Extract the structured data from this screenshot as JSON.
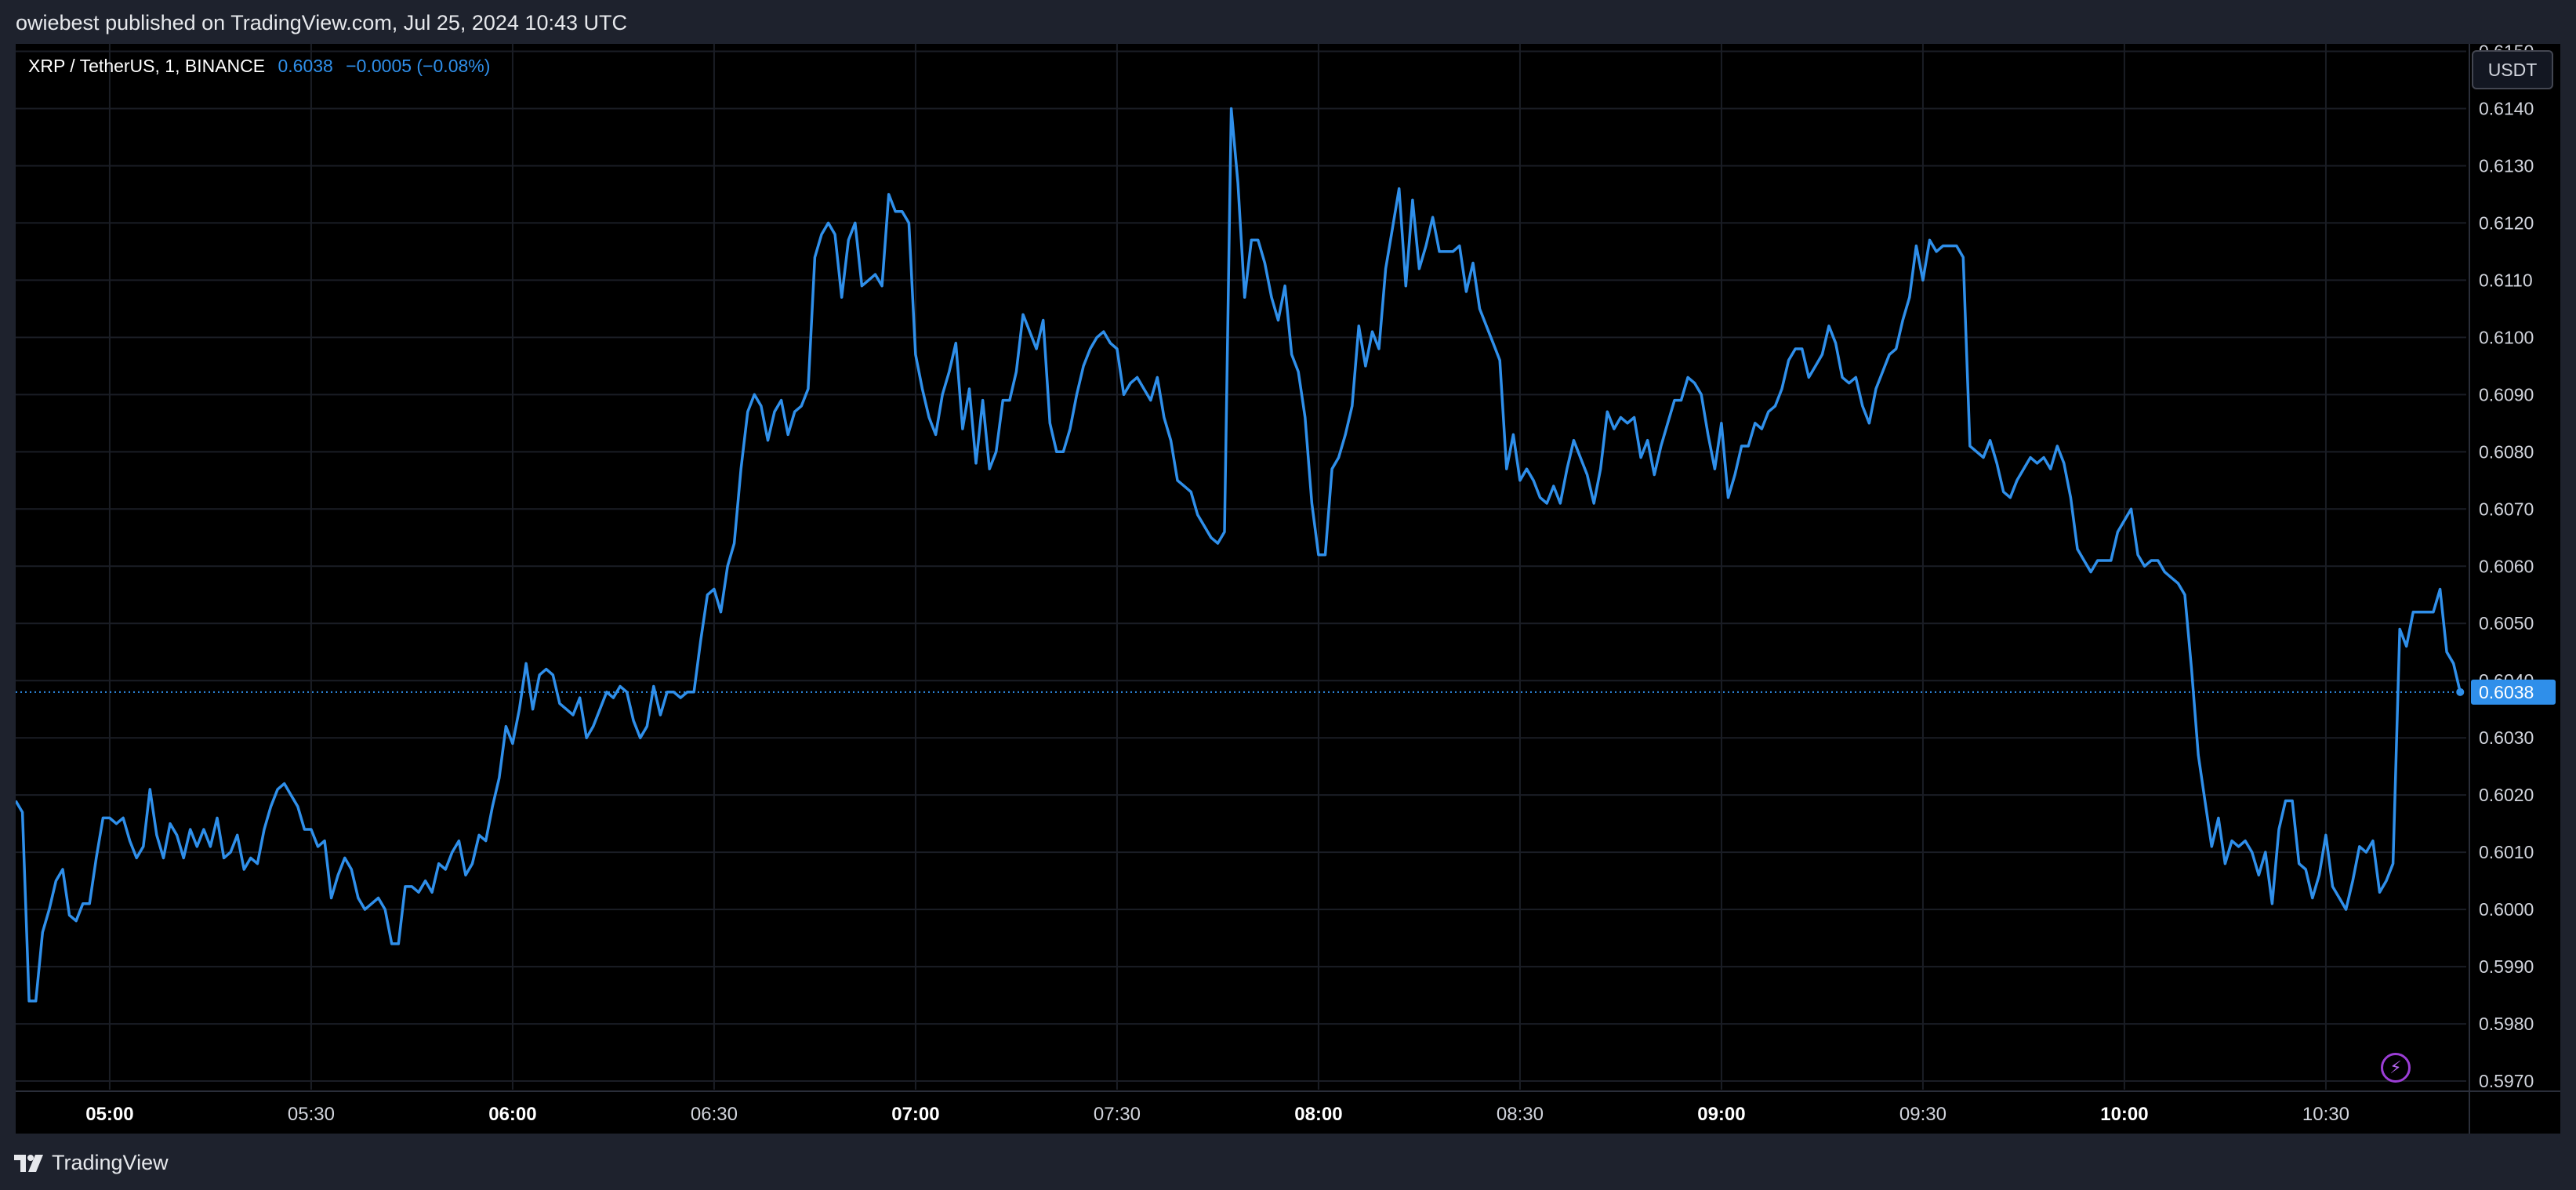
{
  "header": {
    "publisher": "owiebest published on TradingView.com, Jul 25, 2024 10:43 UTC"
  },
  "legend": {
    "symbol": "XRP / TetherUS, 1, BINANCE",
    "price": "0.6038",
    "change": "−0.0005 (−0.08%)"
  },
  "currency": "USDT",
  "footer": {
    "brand": "TradingView"
  },
  "colors": {
    "line": "#2f8fea",
    "background": "#000000",
    "frame": "#1e222d",
    "grid": "#1a1d25",
    "axis_text": "#d1d4dc",
    "badge": "#2f8fea"
  },
  "icons": [
    "tradingview-logo-icon",
    "lightning-icon"
  ],
  "chart_data": {
    "type": "line",
    "series": [
      {
        "values": [
          0.6019,
          0.6017,
          0.5984,
          0.5984,
          0.5996,
          0.6,
          0.6005,
          0.6007,
          0.5999,
          0.5998,
          0.6001,
          0.6001,
          0.6009,
          0.6016,
          0.6016,
          0.6015,
          0.6016,
          0.6012,
          0.6009,
          0.6011,
          0.6021,
          0.6013,
          0.6009,
          0.6015,
          0.6013,
          0.6009,
          0.6014,
          0.6011,
          0.6014,
          0.6011,
          0.6016,
          0.6009,
          0.601,
          0.6013,
          0.6007,
          0.6009,
          0.6008,
          0.6014,
          0.6018,
          0.6021,
          0.6022,
          0.602,
          0.6018,
          0.6014,
          0.6014,
          0.6011,
          0.6012,
          0.6002,
          0.6006,
          0.6009,
          0.6007,
          0.6002,
          0.6,
          0.6001,
          0.6002,
          0.6,
          0.5994,
          0.5994,
          0.6004,
          0.6004,
          0.6003,
          0.6005,
          0.6003,
          0.6008,
          0.6007,
          0.601,
          0.6012,
          0.6006,
          0.6008,
          0.6013,
          0.6012,
          0.6018,
          0.6023,
          0.6032,
          0.6029,
          0.6035,
          0.6043,
          0.6035,
          0.6041,
          0.6042,
          0.6041,
          0.6036,
          0.6035,
          0.6034,
          0.6037,
          0.603,
          0.6032,
          0.6035,
          0.6038,
          0.6037,
          0.6039,
          0.6038,
          0.6033,
          0.603,
          0.6032,
          0.6039,
          0.6034,
          0.6038,
          0.6038,
          0.6037,
          0.6038,
          0.6038,
          0.6047,
          0.6055,
          0.6056,
          0.6052,
          0.606,
          0.6064,
          0.6077,
          0.6087,
          0.609,
          0.6088,
          0.6082,
          0.6087,
          0.6089,
          0.6083,
          0.6087,
          0.6088,
          0.6091,
          0.6114,
          0.6118,
          0.612,
          0.6118,
          0.6107,
          0.6117,
          0.612,
          0.6109,
          0.611,
          0.6111,
          0.6109,
          0.6125,
          0.6122,
          0.6122,
          0.612,
          0.6097,
          0.6091,
          0.6086,
          0.6083,
          0.609,
          0.6094,
          0.6099,
          0.6084,
          0.6091,
          0.6078,
          0.6089,
          0.6077,
          0.608,
          0.6089,
          0.6089,
          0.6094,
          0.6104,
          0.6101,
          0.6098,
          0.6103,
          0.6085,
          0.608,
          0.608,
          0.6084,
          0.609,
          0.6095,
          0.6098,
          0.61,
          0.6101,
          0.6099,
          0.6098,
          0.609,
          0.6092,
          0.6093,
          0.6091,
          0.6089,
          0.6093,
          0.6086,
          0.6082,
          0.6075,
          0.6074,
          0.6073,
          0.6069,
          0.6067,
          0.6065,
          0.6064,
          0.6066,
          0.614,
          0.6127,
          0.6107,
          0.6117,
          0.6117,
          0.6113,
          0.6107,
          0.6103,
          0.6109,
          0.6097,
          0.6094,
          0.6086,
          0.6071,
          0.6062,
          0.6062,
          0.6077,
          0.6079,
          0.6083,
          0.6088,
          0.6102,
          0.6095,
          0.6101,
          0.6098,
          0.6112,
          0.6119,
          0.6126,
          0.6109,
          0.6124,
          0.6112,
          0.6116,
          0.6121,
          0.6115,
          0.6115,
          0.6115,
          0.6116,
          0.6108,
          0.6113,
          0.6105,
          0.6102,
          0.6099,
          0.6096,
          0.6077,
          0.6083,
          0.6075,
          0.6077,
          0.6075,
          0.6072,
          0.6071,
          0.6074,
          0.6071,
          0.6077,
          0.6082,
          0.6079,
          0.6076,
          0.6071,
          0.6077,
          0.6087,
          0.6084,
          0.6086,
          0.6085,
          0.6086,
          0.6079,
          0.6082,
          0.6076,
          0.6081,
          0.6085,
          0.6089,
          0.6089,
          0.6093,
          0.6092,
          0.609,
          0.6083,
          0.6077,
          0.6085,
          0.6072,
          0.6076,
          0.6081,
          0.6081,
          0.6085,
          0.6084,
          0.6087,
          0.6088,
          0.6091,
          0.6096,
          0.6098,
          0.6098,
          0.6093,
          0.6095,
          0.6097,
          0.6102,
          0.6099,
          0.6093,
          0.6092,
          0.6093,
          0.6088,
          0.6085,
          0.6091,
          0.6094,
          0.6097,
          0.6098,
          0.6103,
          0.6107,
          0.6116,
          0.611,
          0.6117,
          0.6115,
          0.6116,
          0.6116,
          0.6116,
          0.6114,
          0.6081,
          0.608,
          0.6079,
          0.6082,
          0.6078,
          0.6073,
          0.6072,
          0.6075,
          0.6077,
          0.6079,
          0.6078,
          0.6079,
          0.6077,
          0.6081,
          0.6078,
          0.6072,
          0.6063,
          0.6061,
          0.6059,
          0.6061,
          0.6061,
          0.6061,
          0.6066,
          0.6068,
          0.607,
          0.6062,
          0.606,
          0.6061,
          0.6061,
          0.6059,
          0.6058,
          0.6057,
          0.6055,
          0.6042,
          0.6027,
          0.6019,
          0.6011,
          0.6016,
          0.6008,
          0.6012,
          0.6011,
          0.6012,
          0.601,
          0.6006,
          0.601,
          0.6001,
          0.6014,
          0.6019,
          0.6019,
          0.6008,
          0.6007,
          0.6002,
          0.6006,
          0.6013,
          0.6004,
          0.6002,
          0.6,
          0.6005,
          0.6011,
          0.601,
          0.6012,
          0.6003,
          0.6005,
          0.6008,
          0.6049,
          0.6046,
          0.6052,
          0.6052,
          0.6052,
          0.6052,
          0.6056,
          0.6045,
          0.6043,
          0.6038
        ]
      }
    ],
    "x_start": "04:46",
    "x_step_minutes": 1,
    "x_ticks": [
      "05:00",
      "05:30",
      "06:00",
      "06:30",
      "07:00",
      "07:30",
      "08:00",
      "08:30",
      "09:00",
      "09:30",
      "10:00",
      "10:30"
    ],
    "x_ticks_bold": [
      "05:00",
      "06:00",
      "07:00",
      "08:00",
      "09:00",
      "10:00"
    ],
    "y_ticks": [
      "0.5970",
      "0.5980",
      "0.5990",
      "0.6000",
      "0.6010",
      "0.6020",
      "0.6030",
      "0.6040",
      "0.6050",
      "0.6060",
      "0.6070",
      "0.6080",
      "0.6090",
      "0.6100",
      "0.6110",
      "0.6120",
      "0.6130",
      "0.6140",
      "0.6150"
    ],
    "ylim": [
      0.59685,
      0.61513
    ],
    "last_price": 0.6038,
    "last_price_label": "0.6038",
    "grid": true,
    "y_axis_position": "right"
  }
}
